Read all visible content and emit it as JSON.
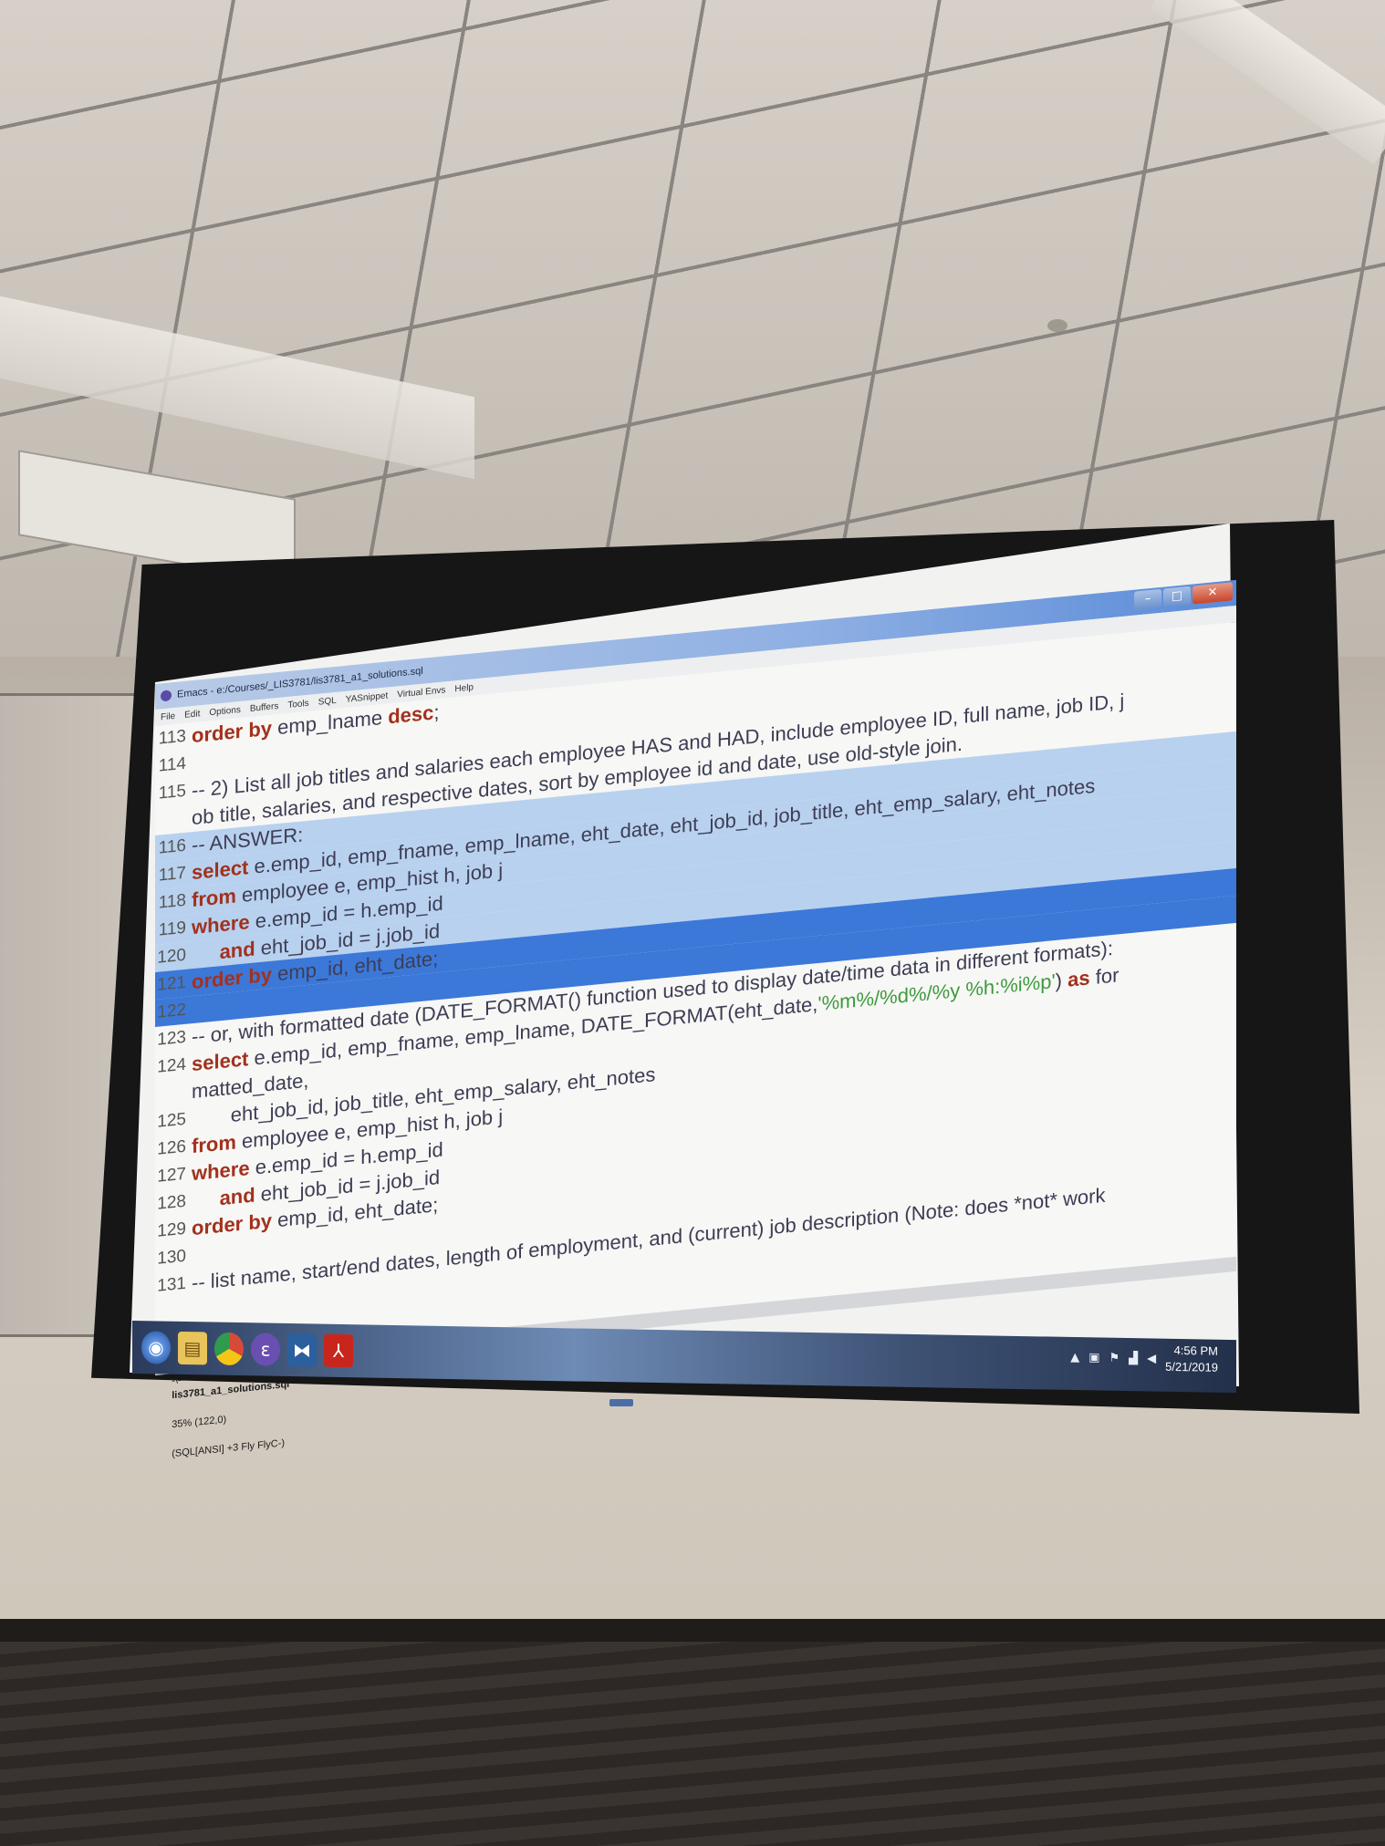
{
  "window": {
    "title": "Emacs - e:/Courses/_LIS3781/lis3781_a1_solutions.sql",
    "controls": [
      "–",
      "□",
      "✕"
    ]
  },
  "menu": [
    "File",
    "Edit",
    "Options",
    "Buffers",
    "Tools",
    "SQL",
    "YASnippet",
    "Virtual Envs",
    "Help"
  ],
  "lines": [
    {
      "n": "113",
      "segs": [
        [
          "kw",
          "order by"
        ],
        [
          "",
          " emp_lname "
        ],
        [
          "kw",
          "desc"
        ],
        [
          "",
          ";"
        ]
      ],
      "hl": ""
    },
    {
      "n": "114",
      "segs": [],
      "hl": ""
    },
    {
      "n": "115",
      "segs": [
        [
          "cmt",
          "-- 2) List all job titles and salaries each employee HAS and HAD, include employee ID, full name, job ID, j"
        ]
      ],
      "hl": ""
    },
    {
      "n": "",
      "segs": [
        [
          "cmt",
          "ob title, salaries, and respective dates, sort by employee id and date, use old-style join."
        ]
      ],
      "hl": ""
    },
    {
      "n": "116",
      "segs": [
        [
          "cmt",
          "-- ANSWER:"
        ]
      ],
      "hl": "hl"
    },
    {
      "n": "117",
      "segs": [
        [
          "kw",
          "select"
        ],
        [
          "",
          " e.emp_id, emp_fname, emp_lname, eht_date, eht_job_id, job_title, eht_emp_salary, eht_notes"
        ]
      ],
      "hl": "hl"
    },
    {
      "n": "118",
      "segs": [
        [
          "kw",
          "from"
        ],
        [
          "",
          " employee e, emp_hist h, job j"
        ]
      ],
      "hl": "hl"
    },
    {
      "n": "119",
      "segs": [
        [
          "kw",
          "where"
        ],
        [
          "",
          " e.emp_id = h.emp_id"
        ]
      ],
      "hl": "hl"
    },
    {
      "n": "120",
      "segs": [
        [
          "",
          "     "
        ],
        [
          "kw",
          "and"
        ],
        [
          "",
          " eht_job_id = j.job_id"
        ]
      ],
      "hl": "hl"
    },
    {
      "n": "121",
      "segs": [
        [
          "kw",
          "order by"
        ],
        [
          "",
          " emp_id, eht_date;"
        ]
      ],
      "hl": "hl-strong"
    },
    {
      "n": "122",
      "segs": [],
      "hl": "hl-strong"
    },
    {
      "n": "123",
      "segs": [
        [
          "cmt",
          "-- or, with formatted date (DATE_FORMAT() function used to display date/time data in different formats):"
        ]
      ],
      "hl": ""
    },
    {
      "n": "124",
      "segs": [
        [
          "kw",
          "select"
        ],
        [
          "",
          " e.emp_id, emp_fname, emp_lname, DATE_FORMAT(eht_date,"
        ],
        [
          "str",
          "'%m%/%d%/%y %h:%i%p'"
        ],
        [
          "",
          ") "
        ],
        [
          "kw",
          "as"
        ],
        [
          "",
          " for"
        ]
      ],
      "hl": ""
    },
    {
      "n": "",
      "segs": [
        [
          "",
          "matted_date,"
        ]
      ],
      "hl": ""
    },
    {
      "n": "125",
      "segs": [
        [
          "",
          "       eht_job_id, job_title, eht_emp_salary, eht_notes"
        ]
      ],
      "hl": ""
    },
    {
      "n": "126",
      "segs": [
        [
          "kw",
          "from"
        ],
        [
          "",
          " employee e, emp_hist h, job j"
        ]
      ],
      "hl": ""
    },
    {
      "n": "127",
      "segs": [
        [
          "kw",
          "where"
        ],
        [
          "",
          " e.emp_id = h.emp_id"
        ]
      ],
      "hl": ""
    },
    {
      "n": "128",
      "segs": [
        [
          "",
          "     "
        ],
        [
          "kw",
          "and"
        ],
        [
          "",
          " eht_job_id = j.job_id"
        ]
      ],
      "hl": ""
    },
    {
      "n": "129",
      "segs": [
        [
          "kw",
          "order by"
        ],
        [
          "",
          " emp_id, eht_date;"
        ]
      ],
      "hl": ""
    },
    {
      "n": "130",
      "segs": [],
      "hl": ""
    },
    {
      "n": "131",
      "segs": [
        [
          "cmt",
          "-- list name, start/end dates, length of employment, and (current) job description (Note: does *not* work"
        ]
      ],
      "hl": ""
    }
  ],
  "modeline": {
    "prefix": "-\\---",
    "buffer": "lis3781_a1_solutions.sql",
    "position": "35% (122,0)",
    "modes": "(SQL[ANSI] +3 Fly FlyC-)"
  },
  "taskbar": {
    "icons": [
      {
        "name": "start-icon",
        "glyph": "◉"
      },
      {
        "name": "explorer-icon",
        "glyph": "▤"
      },
      {
        "name": "chrome-icon",
        "glyph": ""
      },
      {
        "name": "emacs-icon",
        "glyph": "ε"
      },
      {
        "name": "sql-icon",
        "glyph": "⧓"
      },
      {
        "name": "pdf-icon",
        "glyph": "⅄"
      }
    ],
    "time": "4:56 PM",
    "date": "5/21/2019"
  }
}
